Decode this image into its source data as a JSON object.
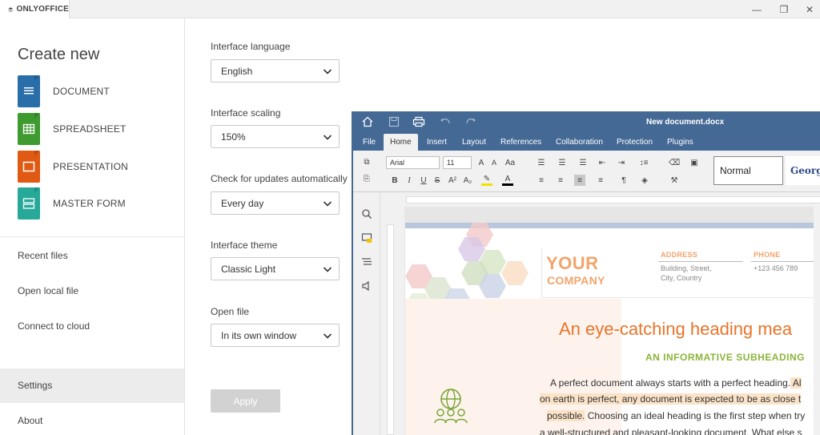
{
  "app": {
    "name": "ONLYOFFICE"
  },
  "window": {
    "minimize": "—",
    "restore": "❐",
    "close": "✕"
  },
  "sidebar": {
    "create_title": "Create new",
    "create_items": [
      {
        "label": "DOCUMENT",
        "color": "#2a6ea9"
      },
      {
        "label": "SPREADSHEET",
        "color": "#3f9a2f"
      },
      {
        "label": "PRESENTATION",
        "color": "#e05a14"
      },
      {
        "label": "MASTER FORM",
        "color": "#27a99a"
      }
    ],
    "links": {
      "recent": "Recent files",
      "open_local": "Open local file",
      "connect_cloud": "Connect to cloud",
      "settings": "Settings",
      "about": "About"
    }
  },
  "settings": {
    "language": {
      "label": "Interface language",
      "value": "English"
    },
    "scaling": {
      "label": "Interface scaling",
      "value": "150%"
    },
    "updates": {
      "label": "Check for updates automatically",
      "value": "Every day"
    },
    "theme": {
      "label": "Interface theme",
      "value": "Classic Light"
    },
    "open_file": {
      "label": "Open file",
      "value": "In its own window"
    },
    "apply": "Apply"
  },
  "editor": {
    "doc_title": "New document.docx",
    "tabs": [
      "File",
      "Home",
      "Insert",
      "Layout",
      "References",
      "Collaboration",
      "Protection",
      "Plugins"
    ],
    "active_tab": "Home",
    "font_name": "Arial",
    "font_size": "11",
    "style_normal": "Normal",
    "style_next": "Georgi",
    "accent_color": "#446995"
  },
  "document": {
    "your": "YOUR",
    "company": "COMPANY",
    "address_title": "ADDRESS",
    "address_line1": "Building, Street,",
    "address_line2": "City, Country",
    "phone_title": "PHONE",
    "phone_value": "+123 456 789",
    "heading": "An eye-catching heading mea",
    "subheading": "AN INFORMATIVE SUBHEADING",
    "line1_a": "A perfect document always starts with a perfect heading.",
    "line1_b": " Al",
    "line2": "on earth is perfect, any document is expected to be as close t",
    "line3_a": "possible.",
    "line3_b": " Choosing an ideal heading is the first step when try",
    "line4": "a well-structured and pleasant-looking document. What else s"
  }
}
